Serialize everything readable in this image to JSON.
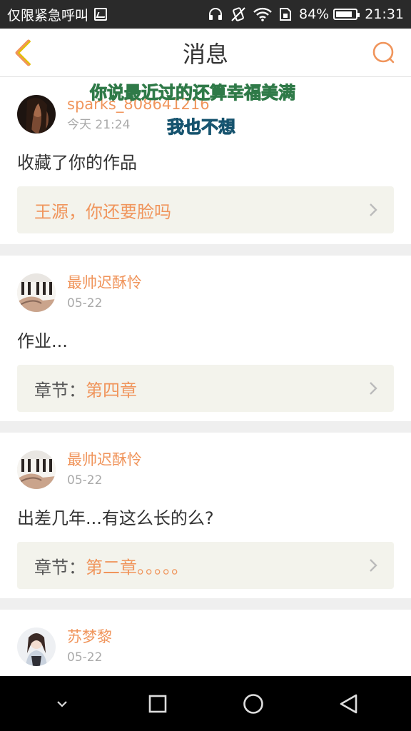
{
  "status_bar": {
    "carrier": "仅限紧急呼叫",
    "battery_percent": "84%",
    "battery_level": 0.84,
    "time": "21:31",
    "icons": [
      "image-icon",
      "headphones-icon",
      "vibrate-icon",
      "wifi-icon",
      "sim-icon",
      "battery-icon"
    ]
  },
  "header": {
    "title": "消息",
    "back_icon": "chevron-left-icon",
    "search_icon": "search-icon",
    "accent": "#f0955c"
  },
  "overlay": {
    "line1": "你说最近过的还算幸福美满",
    "line2": "我也不想"
  },
  "messages": [
    {
      "username": "sparks_808641216",
      "date": "今天 21:24",
      "comment": "收藏了你的作品",
      "ref_label": "",
      "ref_value": "王源，你还要脸吗"
    },
    {
      "username": "最帅迟酥怜",
      "date": "05-22",
      "comment": "作业...",
      "ref_label": "章节：",
      "ref_value": "第四章"
    },
    {
      "username": "最帅迟酥怜",
      "date": "05-22",
      "comment": "出差几年...有这么长的么?",
      "ref_label": "章节：",
      "ref_value": "第二章。。。。。"
    },
    {
      "username": "苏梦黎",
      "date": "05-22",
      "comment": "",
      "ref_label": "",
      "ref_value": ""
    }
  ],
  "navbar": {
    "icons": [
      "chevron-down-icon",
      "recents-icon",
      "home-icon",
      "back-triangle-icon"
    ]
  }
}
